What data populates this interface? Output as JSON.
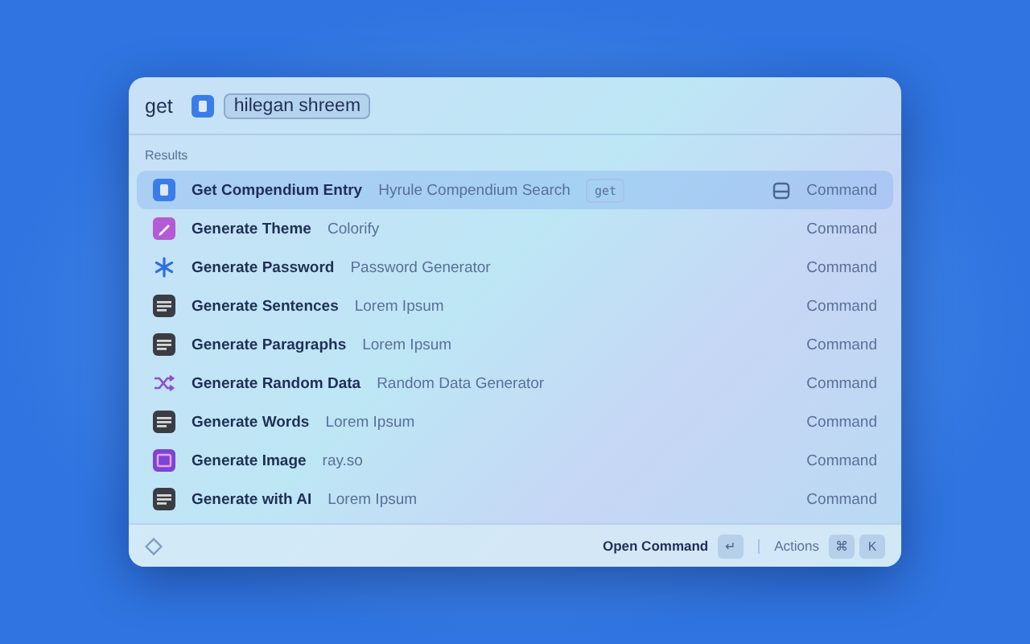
{
  "search": {
    "keyword": "get",
    "argument": "hilegan shreem"
  },
  "section_title": "Results",
  "results": [
    {
      "title": "Get Compendium Entry",
      "subtitle": "Hyrule Compendium Search",
      "tag": "get",
      "accessory": "Command",
      "kind": "document",
      "selected": true
    },
    {
      "title": "Generate Theme",
      "subtitle": "Colorify",
      "accessory": "Command",
      "kind": "pencil",
      "selected": false
    },
    {
      "title": "Generate Password",
      "subtitle": "Password Generator",
      "accessory": "Command",
      "kind": "asterisk",
      "selected": false
    },
    {
      "title": "Generate Sentences",
      "subtitle": "Lorem Ipsum",
      "accessory": "Command",
      "kind": "terminal",
      "selected": false
    },
    {
      "title": "Generate Paragraphs",
      "subtitle": "Lorem Ipsum",
      "accessory": "Command",
      "kind": "terminal",
      "selected": false
    },
    {
      "title": "Generate Random Data",
      "subtitle": "Random Data Generator",
      "accessory": "Command",
      "kind": "shuffle",
      "selected": false
    },
    {
      "title": "Generate Words",
      "subtitle": "Lorem Ipsum",
      "accessory": "Command",
      "kind": "terminal",
      "selected": false
    },
    {
      "title": "Generate Image",
      "subtitle": "ray.so",
      "accessory": "Command",
      "kind": "image",
      "selected": false
    },
    {
      "title": "Generate with AI",
      "subtitle": "Lorem Ipsum",
      "accessory": "Command",
      "kind": "terminal",
      "selected": false
    }
  ],
  "footer": {
    "primary_action": "Open Command",
    "primary_key": "↵",
    "actions_label": "Actions",
    "action_keys": [
      "⌘",
      "K"
    ]
  }
}
